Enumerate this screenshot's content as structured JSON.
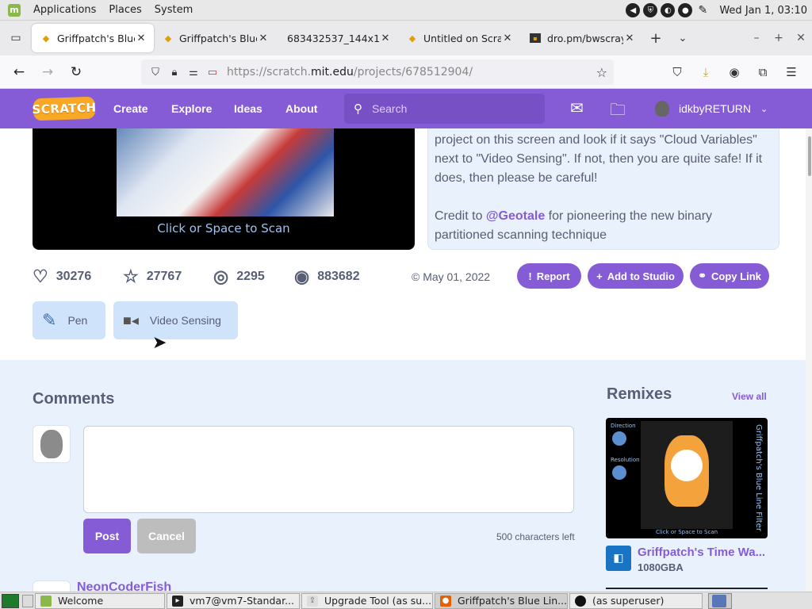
{
  "system_panel": {
    "menus": [
      "Applications",
      "Places",
      "System"
    ],
    "clock": "Wed Jan  1, 03:10"
  },
  "browser": {
    "tabs": [
      {
        "title": "Griffpatch's Blue",
        "active": true
      },
      {
        "title": "Griffpatch's Blue",
        "active": false
      },
      {
        "title": "683432537_144x10",
        "active": false
      },
      {
        "title": "Untitled on Scra",
        "active": false
      },
      {
        "title": "dro.pm/bwscray",
        "active": false
      }
    ],
    "url": {
      "prefix": "https://scratch.",
      "domain": "mit.edu",
      "path": "/projects/678512904/"
    }
  },
  "scratch_nav": {
    "logo": "SCRATCH",
    "links": {
      "create": "Create",
      "explore": "Explore",
      "ideas": "Ideas",
      "about": "About"
    },
    "search_placeholder": "Search",
    "username": "idkbyRETURN"
  },
  "project": {
    "stage_prompt": "Click or Space to Scan",
    "notes": {
      "line1": "project on this screen and look if it says \"Cloud Variables\" next to \"Video Sensing\". If not, then you are quite safe! If it does, then please be careful!",
      "credit_prefix": "Credit to ",
      "credit_link": "@Geotale",
      "credit_suffix": " for pioneering the new binary partitioned scanning technique"
    },
    "stats": {
      "loves": "30276",
      "favorites": "27767",
      "remixes": "2295",
      "views": "883682"
    },
    "date": "May 01, 2022",
    "buttons": {
      "report": "Report",
      "add_to_studio": "Add to Studio",
      "copy_link": "Copy Link"
    },
    "extensions": [
      "Pen",
      "Video Sensing"
    ]
  },
  "comments": {
    "title": "Comments",
    "post_label": "Post",
    "cancel_label": "Cancel",
    "chars_left": "500 characters left",
    "next_commenter": "NeonCoderFish"
  },
  "remixes": {
    "title": "Remixes",
    "view_all": "View all",
    "thumb_labels": {
      "direction": "Direction",
      "resolution": "Resolution",
      "vertical_title": "Griffpatch's Blue Line Filter",
      "footer": "Click or Space to Scan"
    },
    "items": [
      {
        "title": "Griffpatch's Time Wa...",
        "author": "1080GBA"
      }
    ]
  },
  "taskbar": {
    "items": [
      {
        "label": "Welcome",
        "active": false
      },
      {
        "label": "vm7@vm7-Standar...",
        "active": false
      },
      {
        "label": "Upgrade Tool (as su...",
        "active": false
      },
      {
        "label": "Griffpatch's Blue Lin...",
        "active": true
      },
      {
        "label": "(as superuser)",
        "active": false
      }
    ]
  },
  "colors": {
    "scratch_purple": "#855cd6",
    "notes_bg": "#e9f1fc",
    "text_gray": "#575e75"
  }
}
